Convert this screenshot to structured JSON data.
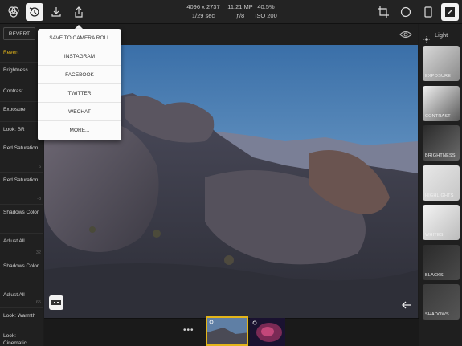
{
  "toolbar": {
    "left_icons": [
      "filters-icon",
      "history-icon",
      "download-icon",
      "share-icon"
    ],
    "right_icons": [
      "crop-icon",
      "circle-icon",
      "portrait-icon",
      "edit-icon"
    ]
  },
  "photo_info": {
    "dimensions": "4096 x 2737",
    "megapixels": "11.21 MP",
    "zoom": "40.5%",
    "shutter": "1/29 sec",
    "aperture": "ƒ/8",
    "iso": "ISO 200"
  },
  "revert_button": "REVERT",
  "history": [
    {
      "label": "Revert",
      "value": ""
    },
    {
      "label": "Brightness",
      "value": ""
    },
    {
      "label": "Contrast",
      "value": "2"
    },
    {
      "label": "Exposure",
      "value": "2"
    },
    {
      "label": "Look: BR",
      "value": ""
    },
    {
      "label": "Red Saturation",
      "value": "6"
    },
    {
      "label": "Red Saturation",
      "value": "-8"
    },
    {
      "label": "Shadows Color",
      "value": ""
    },
    {
      "label": "Adjust All",
      "value": "32"
    },
    {
      "label": "Shadows Color",
      "value": ""
    },
    {
      "label": "Adjust All",
      "value": "65"
    },
    {
      "label": "Look: Warmth",
      "value": ""
    },
    {
      "label": "Look: Cinematic",
      "value": ""
    }
  ],
  "share_menu": [
    "SAVE TO CAMERA ROLL",
    "INSTAGRAM",
    "FACEBOOK",
    "TWITTER",
    "WECHAT",
    "MORE..."
  ],
  "right_panel": {
    "title": "Light",
    "tiles": [
      "EXPOSURE",
      "CONTRAST",
      "BRIGHTNESS",
      "HIGHLIGHTS",
      "WHITES",
      "BLACKS",
      "SHADOWS"
    ]
  },
  "filmstrip": {
    "more": "•••",
    "thumbnails": [
      "desert-landscape-thumbnail",
      "nebula-thumbnail"
    ]
  },
  "colors": {
    "accent": "#e3b51a",
    "background": "#1c1c1c"
  }
}
